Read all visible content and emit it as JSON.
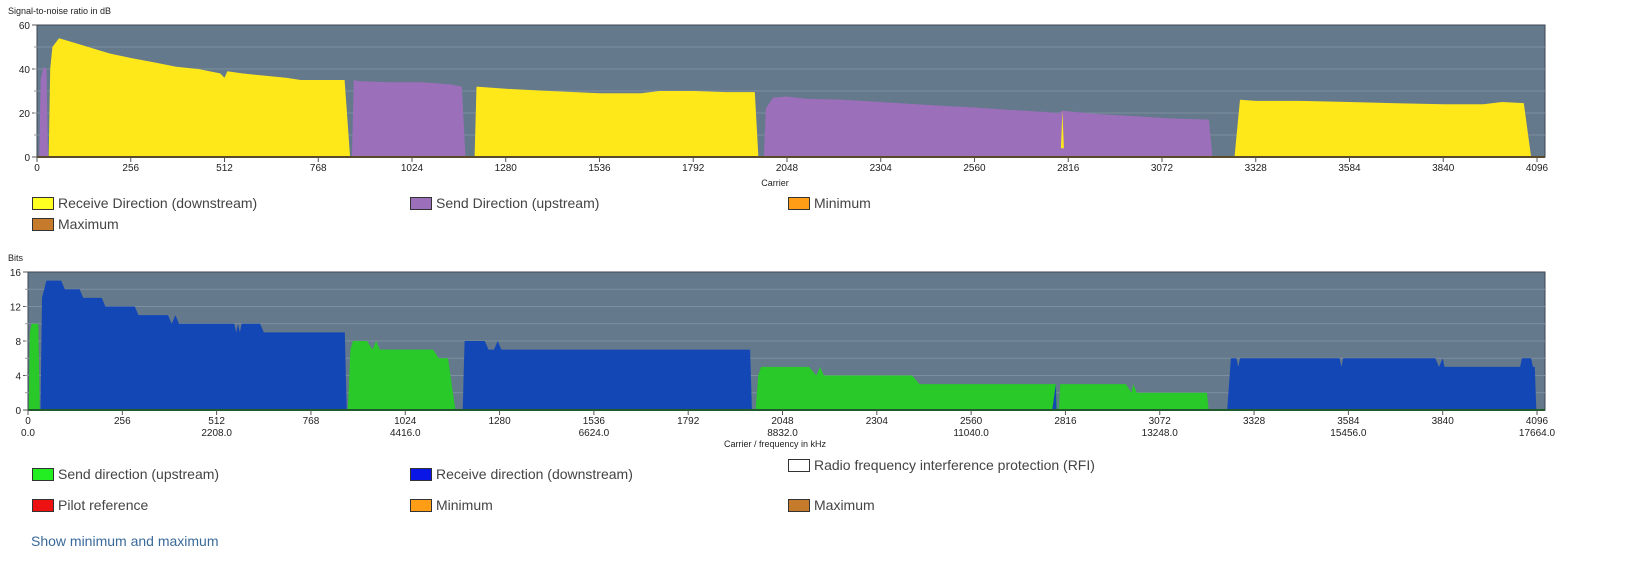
{
  "chart_data": [
    {
      "type": "area",
      "title": "Signal-to-noise ratio in dB",
      "ylabel": "Signal-to-noise ratio in dB",
      "xlabel": "Carrier",
      "xlim": [
        0,
        4096
      ],
      "ylim": [
        0,
        60
      ],
      "yticks": [
        0,
        20,
        40,
        60
      ],
      "xticks": [
        0,
        256,
        512,
        768,
        1024,
        1280,
        1536,
        1792,
        2048,
        2304,
        2560,
        2816,
        3072,
        3328,
        3584,
        3840,
        4096
      ],
      "grid": true,
      "background": "#64798c",
      "series": [
        {
          "name": "Send Direction (upstream)",
          "color": "#9b6fb9",
          "segments": [
            [
              [
                6,
                0
              ],
              [
                10,
                35
              ],
              [
                18,
                41
              ],
              [
                26,
                40
              ],
              [
                30,
                0
              ]
            ],
            [
              [
                860,
                0
              ],
              [
                865,
                35
              ],
              [
                880,
                34.5
              ],
              [
                960,
                34
              ],
              [
                1050,
                34
              ],
              [
                1130,
                33
              ],
              [
                1160,
                32
              ],
              [
                1170,
                0
              ]
            ],
            [
              [
                1985,
                0
              ],
              [
                1990,
                22
              ],
              [
                2010,
                27
              ],
              [
                2048,
                27.5
              ],
              [
                2100,
                26.5
              ],
              [
                2200,
                26
              ],
              [
                2304,
                25
              ],
              [
                2400,
                24
              ],
              [
                2500,
                23
              ],
              [
                2560,
                22.5
              ],
              [
                2650,
                21.5
              ],
              [
                2750,
                20.5
              ],
              [
                2790,
                20
              ],
              [
                2800,
                21
              ],
              [
                2900,
                19.5
              ],
              [
                3000,
                18.5
              ],
              [
                3100,
                17.5
              ],
              [
                3200,
                17
              ],
              [
                3210,
                0
              ]
            ]
          ]
        },
        {
          "name": "Receive Direction (downstream)",
          "color": "#ffe81a",
          "segments": [
            [
              [
                32,
                0
              ],
              [
                36,
                40
              ],
              [
                42,
                50
              ],
              [
                60,
                54
              ],
              [
                80,
                53
              ],
              [
                120,
                51
              ],
              [
                160,
                49
              ],
              [
                200,
                47
              ],
              [
                256,
                45
              ],
              [
                320,
                43
              ],
              [
                380,
                41
              ],
              [
                440,
                40
              ],
              [
                500,
                38
              ],
              [
                512,
                36
              ],
              [
                520,
                39
              ],
              [
                560,
                38
              ],
              [
                620,
                37
              ],
              [
                680,
                36
              ],
              [
                720,
                35
              ],
              [
                768,
                35
              ],
              [
                840,
                35
              ],
              [
                855,
                0
              ]
            ],
            [
              [
                1195,
                0
              ],
              [
                1200,
                32
              ],
              [
                1280,
                31
              ],
              [
                1400,
                30
              ],
              [
                1536,
                29
              ],
              [
                1650,
                29
              ],
              [
                1700,
                30
              ],
              [
                1792,
                30
              ],
              [
                1880,
                29.5
              ],
              [
                1960,
                29.5
              ],
              [
                1970,
                0
              ]
            ],
            [
              [
                2796,
                4
              ],
              [
                2800,
                21
              ],
              [
                2804,
                4
              ]
            ],
            [
              [
                3270,
                0
              ],
              [
                3285,
                26
              ],
              [
                3328,
                25.5
              ],
              [
                3450,
                25.5
              ],
              [
                3584,
                25
              ],
              [
                3700,
                24.5
              ],
              [
                3840,
                24
              ],
              [
                3950,
                24
              ],
              [
                4000,
                25
              ],
              [
                4060,
                24.5
              ],
              [
                4080,
                0
              ]
            ]
          ]
        },
        {
          "name": "Minimum",
          "color": "#ff9e16",
          "segments": []
        },
        {
          "name": "Maximum",
          "color": "#c67a2c",
          "segments": []
        }
      ]
    },
    {
      "type": "area",
      "title": "Bits",
      "ylabel": "Bits",
      "xlabel": "Carrier / frequency in kHz",
      "xlim": [
        0,
        4096
      ],
      "ylim": [
        0,
        16
      ],
      "yticks": [
        0,
        4,
        8,
        12,
        16
      ],
      "xticks": [
        0,
        256,
        512,
        768,
        1024,
        1280,
        1536,
        1792,
        2048,
        2304,
        2560,
        2816,
        3072,
        3328,
        3584,
        3840,
        4096
      ],
      "xticks_khz": [
        "0.0",
        "",
        "2208.0",
        "",
        "4416.0",
        "",
        "6624.0",
        "",
        "8832.0",
        "",
        "11040.0",
        "",
        "13248.0",
        "",
        "15456.0",
        "",
        "17664.0"
      ],
      "grid": true,
      "background": "#64798c",
      "series": [
        {
          "name": "Send direction (upstream)",
          "color": "#28c928",
          "segments": [
            [
              [
                2,
                0
              ],
              [
                5,
                9
              ],
              [
                10,
                10
              ],
              [
                28,
                10
              ],
              [
                32,
                0
              ]
            ],
            [
              [
                868,
                0
              ],
              [
                875,
                7
              ],
              [
                882,
                8
              ],
              [
                920,
                8
              ],
              [
                935,
                7
              ],
              [
                945,
                8
              ],
              [
                955,
                7
              ],
              [
                1100,
                7
              ],
              [
                1115,
                6
              ],
              [
                1140,
                6
              ],
              [
                1160,
                0
              ]
            ],
            [
              [
                1975,
                0
              ],
              [
                1982,
                4
              ],
              [
                1990,
                5
              ],
              [
                2120,
                5
              ],
              [
                2140,
                4
              ],
              [
                2150,
                5
              ],
              [
                2160,
                4
              ],
              [
                2400,
                4
              ],
              [
                2420,
                3
              ],
              [
                2790,
                3
              ],
              [
                2794,
                0
              ]
            ],
            [
              [
                2798,
                0
              ],
              [
                2802,
                3
              ],
              [
                2980,
                3
              ],
              [
                2995,
                2
              ],
              [
                3000,
                3
              ],
              [
                3010,
                2
              ],
              [
                3200,
                2
              ],
              [
                3205,
                0
              ]
            ]
          ]
        },
        {
          "name": "Receive direction (downstream)",
          "color": "#1347b5",
          "segments": [
            [
              [
                34,
                0
              ],
              [
                38,
                13
              ],
              [
                50,
                15
              ],
              [
                90,
                15
              ],
              [
                100,
                14
              ],
              [
                140,
                14
              ],
              [
                150,
                13
              ],
              [
                200,
                13
              ],
              [
                210,
                12
              ],
              [
                290,
                12
              ],
              [
                300,
                11
              ],
              [
                380,
                11
              ],
              [
                390,
                10
              ],
              [
                400,
                11
              ],
              [
                410,
                10
              ],
              [
                560,
                10
              ],
              [
                565,
                9
              ],
              [
                570,
                10
              ],
              [
                575,
                9
              ],
              [
                580,
                10
              ],
              [
                630,
                10
              ],
              [
                640,
                9
              ],
              [
                860,
                9
              ],
              [
                865,
                0
              ]
            ],
            [
              [
                1180,
                0
              ],
              [
                1185,
                8
              ],
              [
                1240,
                8
              ],
              [
                1250,
                7
              ],
              [
                1265,
                7
              ],
              [
                1275,
                8
              ],
              [
                1285,
                7
              ],
              [
                1960,
                7
              ],
              [
                1965,
                0
              ]
            ],
            [
              [
                2780,
                0
              ],
              [
                2790,
                3
              ],
              [
                2792,
                0
              ]
            ],
            [
              [
                3255,
                0
              ],
              [
                3265,
                6
              ],
              [
                3280,
                6
              ],
              [
                3285,
                5
              ],
              [
                3290,
                6
              ],
              [
                3560,
                6
              ],
              [
                3565,
                5
              ],
              [
                3570,
                6
              ],
              [
                3820,
                6
              ],
              [
                3830,
                5
              ],
              [
                3840,
                6
              ],
              [
                3845,
                5
              ],
              [
                4050,
                5
              ],
              [
                4055,
                6
              ],
              [
                4080,
                6
              ],
              [
                4085,
                5
              ],
              [
                4090,
                5
              ],
              [
                4094,
                0
              ]
            ]
          ]
        },
        {
          "name": "Radio frequency interference protection (RFI)",
          "color": "#ffffff",
          "segments": []
        },
        {
          "name": "Pilot reference",
          "color": "#ee1111",
          "segments": []
        },
        {
          "name": "Minimum",
          "color": "#ff9e16",
          "segments": []
        },
        {
          "name": "Maximum",
          "color": "#c67a2c",
          "segments": []
        }
      ]
    }
  ],
  "legend1": [
    {
      "label": "Receive Direction (downstream)",
      "color": "#ffff22"
    },
    {
      "label": "Send Direction (upstream)",
      "color": "#9b6fb9"
    },
    {
      "label": "Minimum",
      "color": "#ff9e16"
    },
    {
      "label": "Maximum",
      "color": "#c67a2c"
    }
  ],
  "legend2": [
    {
      "label": "Send direction (upstream)",
      "color": "#22ee22"
    },
    {
      "label": "Receive direction (downstream)",
      "color": "#0a16e6"
    },
    {
      "label": "Radio frequency interference protection (RFI)",
      "color": "#ffffff"
    },
    {
      "label": "Pilot reference",
      "color": "#ee1111"
    },
    {
      "label": "Minimum",
      "color": "#ff9e16"
    },
    {
      "label": "Maximum",
      "color": "#c67a2c"
    }
  ],
  "show_minmax_link": "Show minimum and maximum"
}
